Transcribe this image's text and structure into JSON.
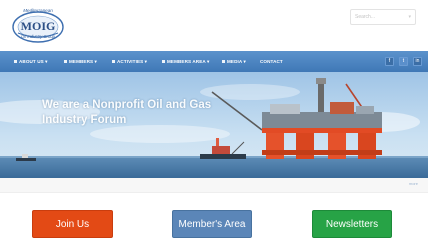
{
  "header": {
    "logo": {
      "line1": "Mediterranean",
      "main": "MOIG",
      "line2": "Oil Industry Group"
    },
    "search": {
      "placeholder": "Search..."
    }
  },
  "nav": {
    "items": [
      {
        "label": "ABOUT US ▾"
      },
      {
        "label": "MEMBERS ▾"
      },
      {
        "label": "ACTIVITIES ▾"
      },
      {
        "label": "MEMBERS AREA ▾"
      },
      {
        "label": "MEDIA ▾"
      },
      {
        "label": "CONTACT"
      }
    ],
    "social": [
      "f",
      "t",
      "in"
    ]
  },
  "hero": {
    "headline_line1": "We are a Nonprofit Oil and Gas",
    "headline_line2": "Industry Forum"
  },
  "strip": {
    "link": "more"
  },
  "actions": {
    "join": "Join Us",
    "members": "Member's Area",
    "newsletters": "Newsletters"
  },
  "colors": {
    "nav": "#4a83c0",
    "join": "#e34a15",
    "members": "#5b86b8",
    "newsletters": "#27a346"
  }
}
